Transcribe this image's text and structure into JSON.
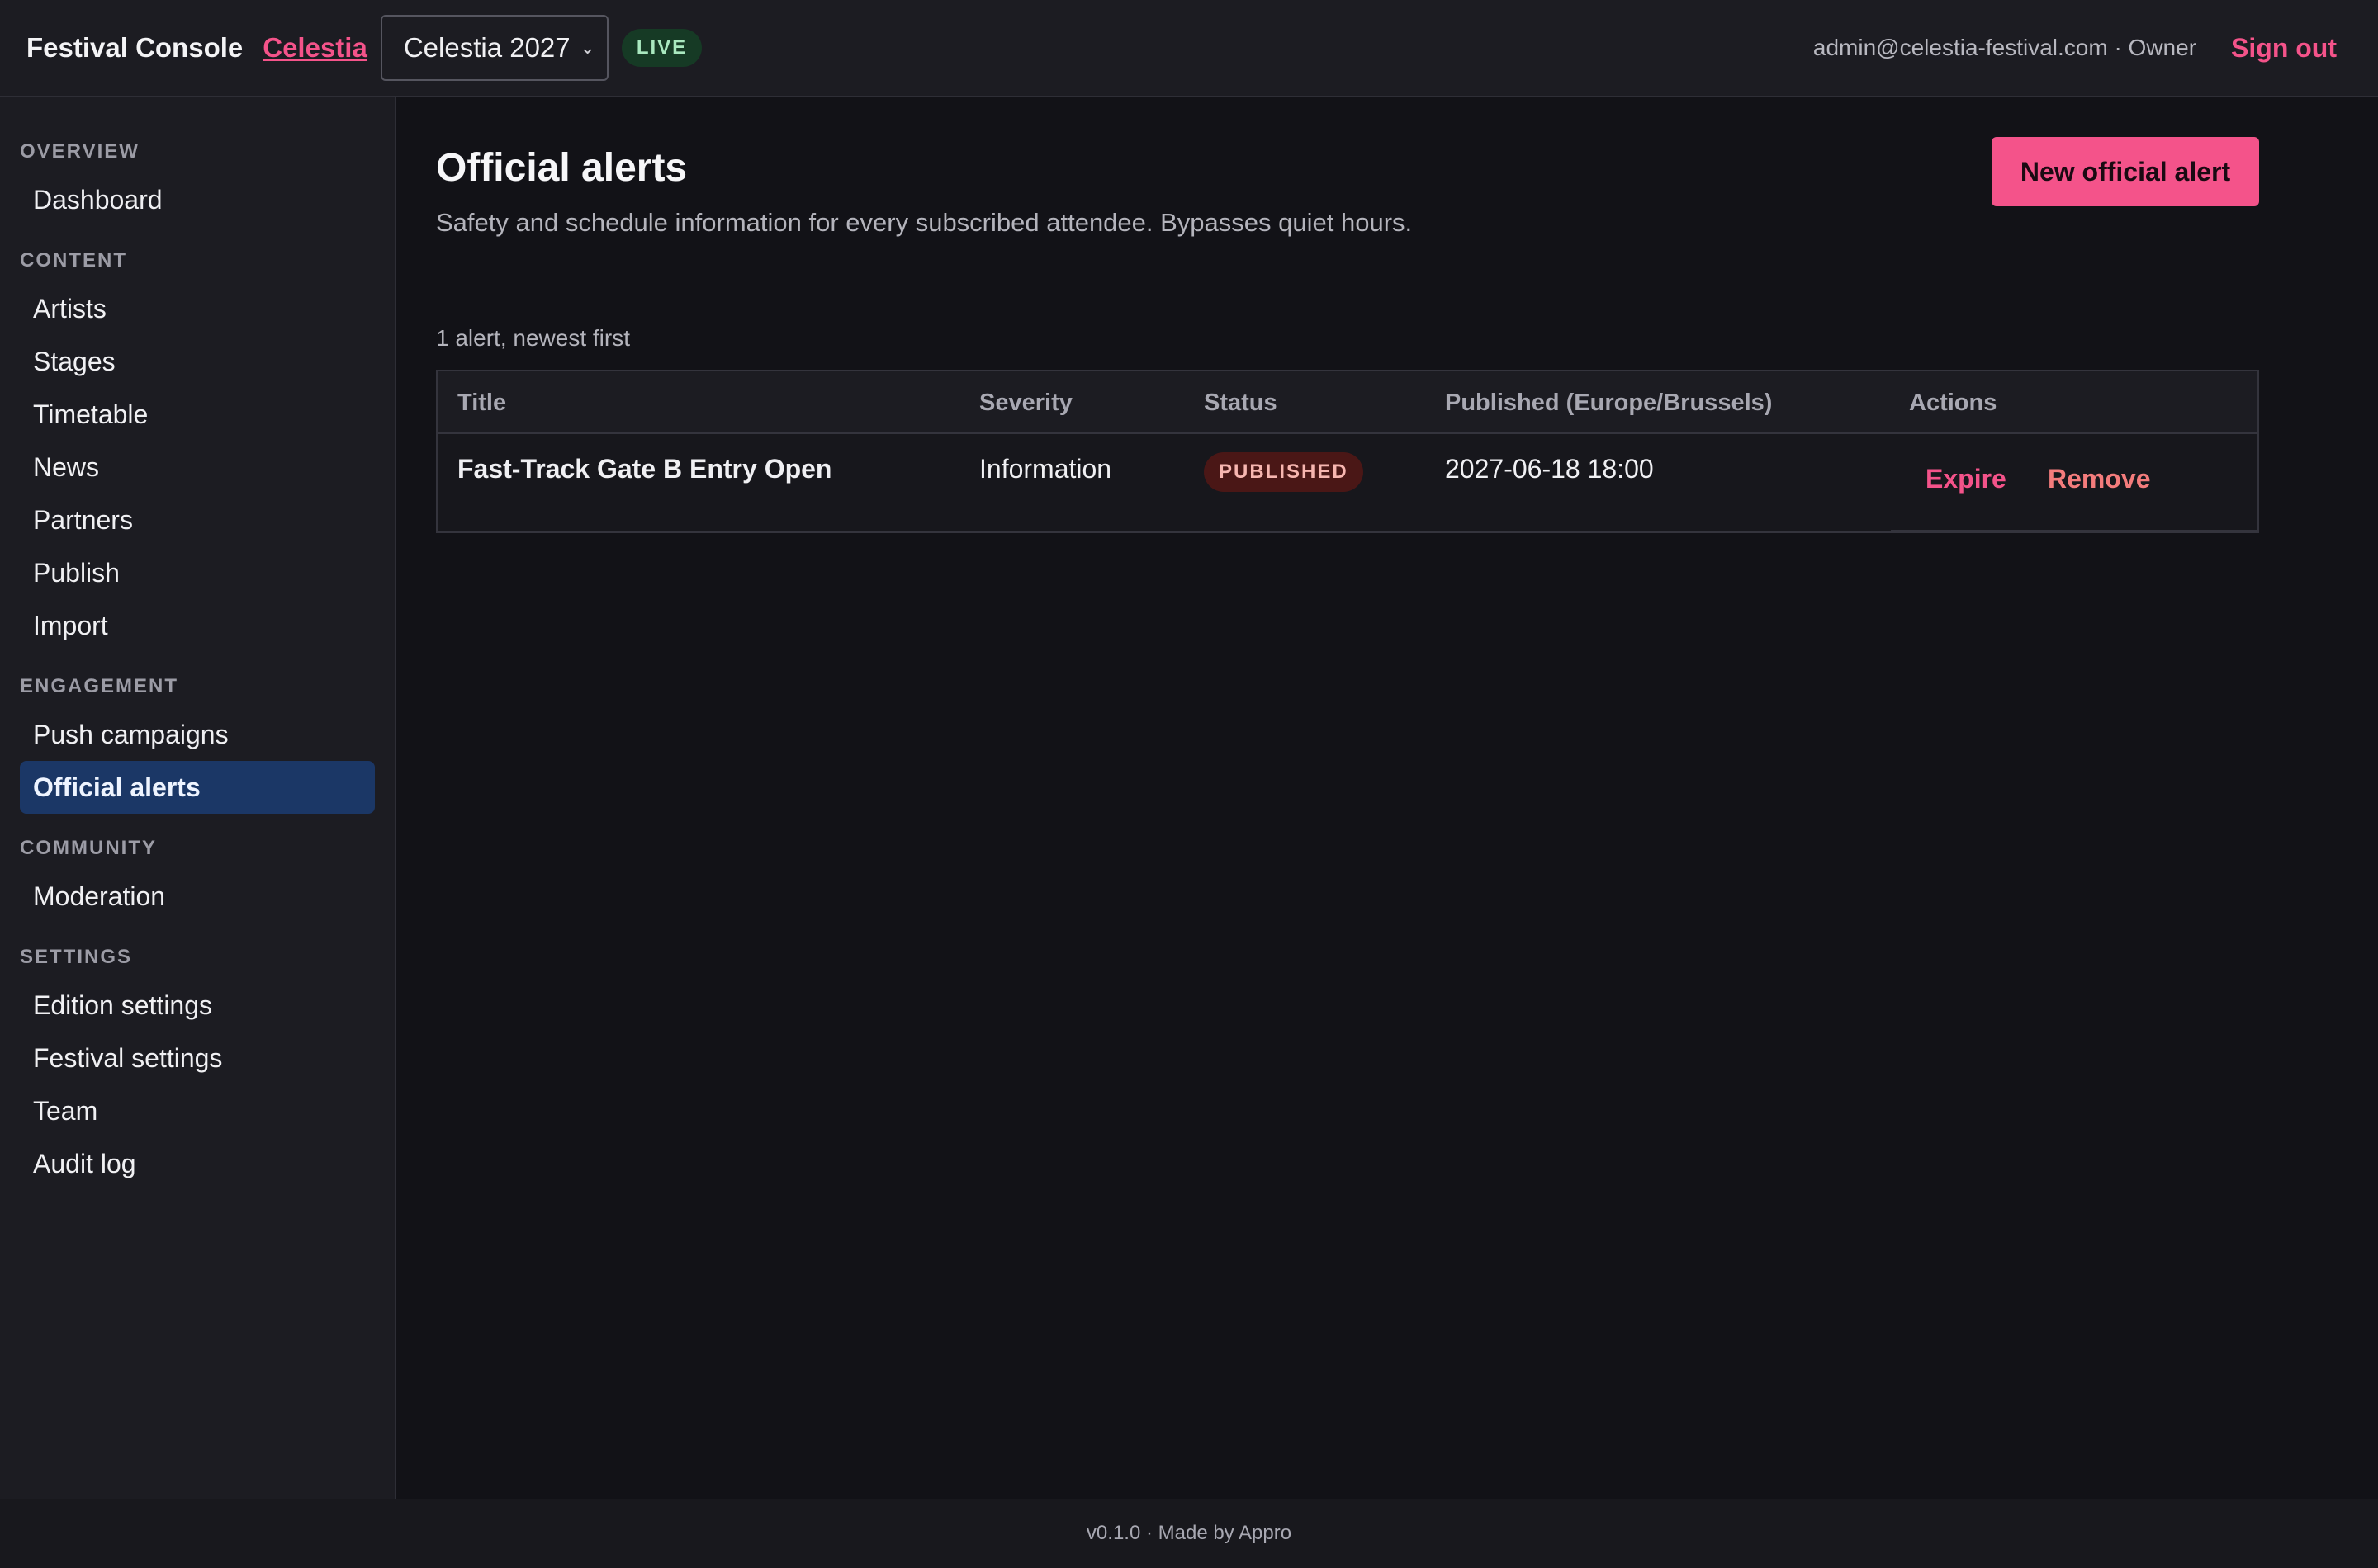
{
  "header": {
    "brand": "Festival Console",
    "org_link": "Celestia",
    "edition_select": "Celestia 2027",
    "live_badge": "LIVE",
    "user": "admin@celestia-festival.com · Owner",
    "sign_out": "Sign out"
  },
  "sidebar": {
    "sections": [
      {
        "label": "OVERVIEW",
        "items": [
          "Dashboard"
        ]
      },
      {
        "label": "CONTENT",
        "items": [
          "Artists",
          "Stages",
          "Timetable",
          "News",
          "Partners",
          "Publish",
          "Import"
        ]
      },
      {
        "label": "ENGAGEMENT",
        "items": [
          "Push campaigns",
          "Official alerts"
        ]
      },
      {
        "label": "COMMUNITY",
        "items": [
          "Moderation"
        ]
      },
      {
        "label": "SETTINGS",
        "items": [
          "Edition settings",
          "Festival settings",
          "Team",
          "Audit log"
        ]
      }
    ],
    "active_item": "Official alerts"
  },
  "main": {
    "title": "Official alerts",
    "subtitle": "Safety and schedule information for every subscribed attendee. Bypasses quiet hours.",
    "new_button": "New official alert",
    "count_text": "1 alert, newest first",
    "table": {
      "columns": [
        "Title",
        "Severity",
        "Status",
        "Published (Europe/Brussels)",
        "Actions"
      ],
      "rows": [
        {
          "title": "Fast-Track Gate B Entry Open",
          "severity": "Information",
          "status": "PUBLISHED",
          "published": "2027-06-18 18:00",
          "actions": [
            "Expire",
            "Remove"
          ]
        }
      ]
    }
  },
  "footer": {
    "text": "v0.1.0 · Made by Appro"
  },
  "colors": {
    "accent": "#f4538a",
    "active_nav_bg": "#1b3766",
    "live_badge_bg": "#163a25",
    "status_published_bg": "#4a1716",
    "remove_action": "#f47c7c"
  },
  "icons": {
    "edition_select_chevron": "chevron-down-icon"
  }
}
